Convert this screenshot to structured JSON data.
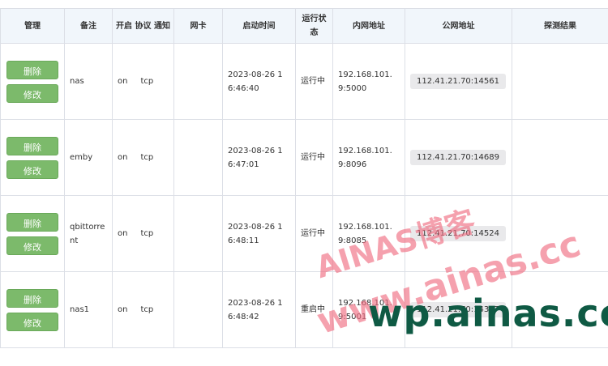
{
  "table": {
    "headers": [
      "管理",
      "备注",
      "开启 协议 通知",
      "网卡",
      "启动时间",
      "运行状态",
      "内网地址",
      "公网地址",
      "探测结果"
    ],
    "rows": [
      {
        "delete_label": "删除",
        "edit_label": "修改",
        "note": "nas",
        "protocol_on": "on",
        "protocol": "tcp",
        "nic": "",
        "start_time": "2023-08-26 16:46:40",
        "status": "运行中",
        "lan_addr": "192.168.101.9:5000",
        "wan_addr": "112.41.21.70:14561",
        "probe_result": ""
      },
      {
        "delete_label": "删除",
        "edit_label": "修改",
        "note": "emby",
        "protocol_on": "on",
        "protocol": "tcp",
        "nic": "",
        "start_time": "2023-08-26 16:47:01",
        "status": "运行中",
        "lan_addr": "192.168.101.9:8096",
        "wan_addr": "112.41.21.70:14689",
        "probe_result": ""
      },
      {
        "delete_label": "删除",
        "edit_label": "修改",
        "note": "qbittorrent",
        "protocol_on": "on",
        "protocol": "tcp",
        "nic": "",
        "start_time": "2023-08-26 16:48:11",
        "status": "运行中",
        "lan_addr": "192.168.101.9:8085",
        "wan_addr": "112.41.21.70:14524",
        "probe_result": ""
      },
      {
        "delete_label": "删除",
        "edit_label": "修改",
        "note": "nas1",
        "protocol_on": "on",
        "protocol": "tcp",
        "nic": "",
        "start_time": "2023-08-26 16:48:42",
        "status": "重启中",
        "lan_addr": "192.168.101.9:5001",
        "wan_addr": "112.41.21.70:14347",
        "probe_result": ""
      }
    ]
  },
  "watermarks": {
    "line1": "AINAS博客",
    "line2": "www.ainas.cc",
    "line3": "wp.ainas.cc"
  }
}
